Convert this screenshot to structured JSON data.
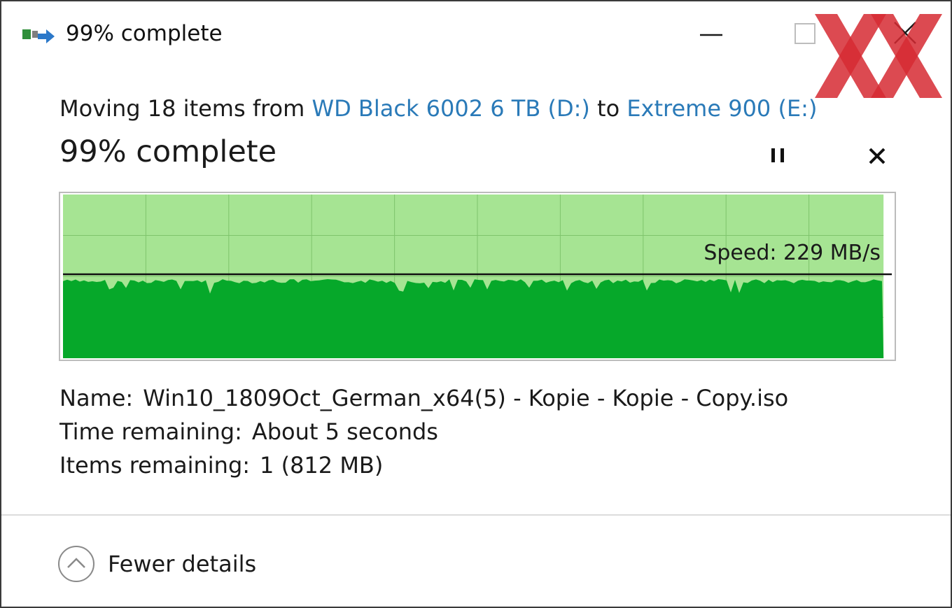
{
  "window": {
    "title": "99% complete",
    "accent_link_color": "#2a7ab8"
  },
  "transfer": {
    "action_prefix": "Moving 18 items from",
    "source": "WD Black 6002 6 TB (D:)",
    "joiner": "to",
    "destination": "Extreme 900 (E:)",
    "progress_text": "99% complete",
    "progress_percent": 99
  },
  "graph": {
    "speed_label": "Speed: 229 MB/s",
    "fill_color": "#06a82a",
    "background_color": "#a6e493"
  },
  "details": {
    "name_key": "Name:",
    "name_value": "Win10_1809Oct_German_x64(5) - Kopie - Kopie - Copy.iso",
    "time_key": "Time remaining:",
    "time_value": "About 5 seconds",
    "items_key": "Items remaining:",
    "items_value": "1 (812 MB)"
  },
  "footer": {
    "fewer_details_label": "Fewer details"
  },
  "icons": {
    "app": "file-transfer-icon",
    "minimize": "minimize-icon",
    "maximize": "maximize-icon",
    "close": "close-icon",
    "pause": "pause-icon",
    "cancel": "cancel-icon",
    "collapse": "chevron-up-icon",
    "watermark": "xx-logo"
  },
  "brand": {
    "logo_color": "#d62a32"
  }
}
